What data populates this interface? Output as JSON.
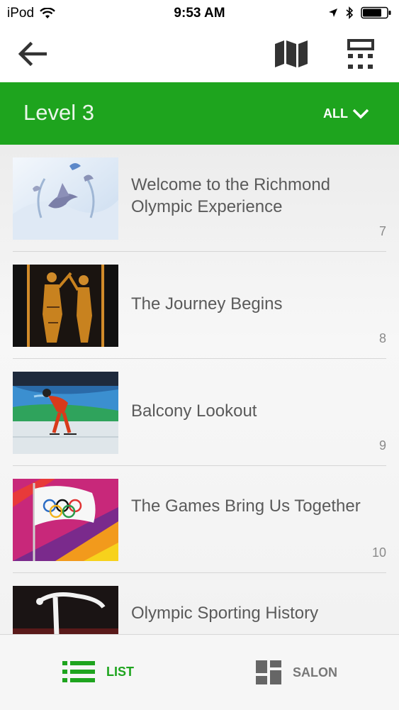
{
  "status_bar": {
    "carrier": "iPod",
    "time": "9:53 AM"
  },
  "navbar": {
    "icons": [
      "back-arrow-icon",
      "map-icon",
      "keypad-icon"
    ]
  },
  "header": {
    "title": "Level 3",
    "filter_label": "ALL"
  },
  "items": [
    {
      "title": "Welcome to the Richmond Olympic Experience",
      "number": "7"
    },
    {
      "title": "The Journey Begins",
      "number": "8"
    },
    {
      "title": "Balcony Lookout",
      "number": "9"
    },
    {
      "title": "The Games Bring Us Together",
      "number": "10"
    },
    {
      "title": "Olympic Sporting History",
      "number": ""
    }
  ],
  "tabs": {
    "list_label": "LIST",
    "salon_label": "SALON"
  },
  "colors": {
    "accent": "#1ea41e",
    "text": "#5a5a5a",
    "number": "#8a8a8a"
  }
}
